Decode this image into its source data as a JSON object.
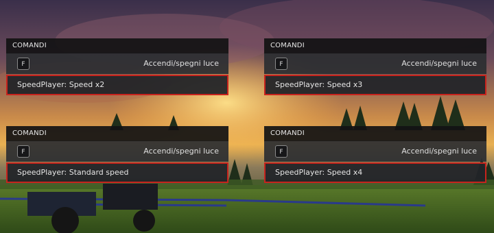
{
  "colors": {
    "panel_bg": "#2c2e32",
    "header_bg": "#121214",
    "highlight_border": "#c8231d",
    "text": "#e6e6e6"
  },
  "panels": [
    {
      "header": "COMANDI",
      "key": "F",
      "action": "Accendi/spegni luce",
      "speed_label": "SpeedPlayer: Speed x2"
    },
    {
      "header": "COMANDI",
      "key": "F",
      "action": "Accendi/spegni luce",
      "speed_label": "SpeedPlayer: Speed x3"
    },
    {
      "header": "COMANDI",
      "key": "F",
      "action": "Accendi/spegni luce",
      "speed_label": "SpeedPlayer: Standard speed"
    },
    {
      "header": "COMANDI",
      "key": "F",
      "action": "Accendi/spegni luce",
      "speed_label": "SpeedPlayer: Speed x4"
    }
  ]
}
